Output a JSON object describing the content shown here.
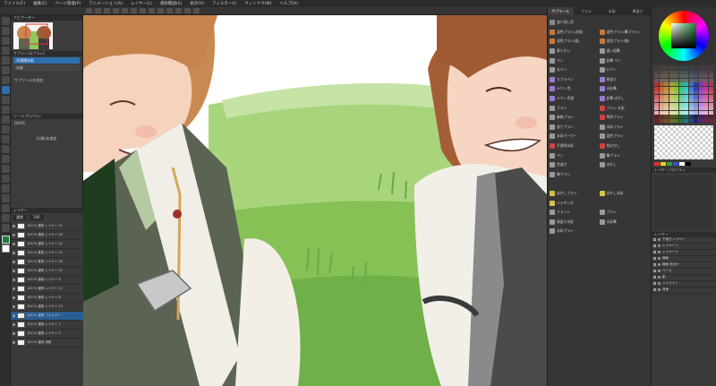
{
  "menu": {
    "items": [
      "ファイル(F)",
      "編集(E)",
      "ページ管理(P)",
      "アニメーション(A)",
      "レイヤー(L)",
      "選択範囲(S)",
      "表示(V)",
      "フィルター(I)",
      "ウィンドウ(W)",
      "ヘルプ(H)"
    ]
  },
  "left_panel": {
    "navigator_label": "ナビゲーター",
    "subtool_header": "サブツール[ブラシ]",
    "subtools": [
      "不透明水彩",
      "水彩"
    ],
    "subtool_note": "サブツールを追加",
    "property_header": "ツールプロパティ",
    "property_tool": "DOOS",
    "property_note": "[対象]未指定"
  },
  "layers": {
    "header": "レイヤー",
    "blend": "通常",
    "opacity": "100",
    "rows": [
      {
        "name": "100 % 通常\nレイヤー 21"
      },
      {
        "name": "100 % 通常\nレイヤー 16"
      },
      {
        "name": "100 % 通常\nレイヤー 22"
      },
      {
        "name": "100 % 乗算\nレイヤー 19"
      },
      {
        "name": "100 % 乗算\nレイヤー 18"
      },
      {
        "name": "100 % 通常\nレイヤー 10"
      },
      {
        "name": "100 % 通常\nレイヤー 9"
      },
      {
        "name": "100 % 通常\nレイヤー 11"
      },
      {
        "name": "100 % 通常\nレイヤー 8"
      },
      {
        "name": "100 % 通常\nレイヤー 13"
      },
      {
        "name": "100 % 通常\nフォルダー 1"
      },
      {
        "name": "100 % 通常\nレイヤー 1"
      },
      {
        "name": "100 % 通常\nレイヤー 5"
      },
      {
        "name": "100 % 通常\n用紙"
      }
    ]
  },
  "brush_panel": {
    "tabs": [
      "サブツール",
      "ブラシ",
      "水彩",
      "厚塗り"
    ],
    "items": [
      [
        "塗り残し用",
        ""
      ],
      [
        "混色ブラシ(点描)",
        "混色ブラシ(筆ブラシ)"
      ],
      [
        "混色ブラシ(面)",
        "混色ブラシ(線)"
      ],
      [
        "柔らかい",
        "濃い鉛筆"
      ],
      [
        "ペン",
        "鉛筆 ペン"
      ],
      [
        "丸ペン",
        "Gペン"
      ],
      [
        "カブラペン",
        "厚塗り"
      ],
      [
        "Gペン 色",
        "水彩筆"
      ],
      [
        "Gペン 色差",
        "鉛筆 ぼかし"
      ],
      [
        "ブラシ",
        "ブラシ 水彩"
      ],
      [
        "麻紙ブラシ",
        "草原ブラシ"
      ],
      [
        "塗りブラシ",
        "水彩ブラシ"
      ],
      [
        "水彩マーカー",
        "混色ブラシ"
      ],
      [
        "不透明水彩",
        "色ぼかし"
      ],
      [
        "ペン",
        "筆ブラシ"
      ],
      [
        "色混ぜ",
        "ぼかし"
      ],
      [
        "線ブラシ",
        ""
      ],
      [
        "",
        ""
      ],
      [
        "ぼかしブラシ",
        "ぼかし水彩"
      ],
      [
        "ジャギング",
        ""
      ],
      [
        "フラット",
        "ブラシ"
      ],
      [
        "厚塗り水彩",
        "水彩筆"
      ],
      [
        "水彩ブラシ",
        ""
      ]
    ]
  },
  "right_panel": {
    "layer_prop_header": "レイヤープロパティ",
    "layer_list_header": "レイヤー",
    "layers": [
      "下描き レイヤー",
      "レイヤー 1",
      "レイヤー 2",
      "線画",
      "線画 色分け",
      "ベース",
      "影",
      "ハイライト",
      "背景"
    ]
  },
  "colors": {
    "accent": "#2f6fb0",
    "grass": "#7fbf4d",
    "skin": "#f6d5c2",
    "hair": "#c9884f"
  }
}
